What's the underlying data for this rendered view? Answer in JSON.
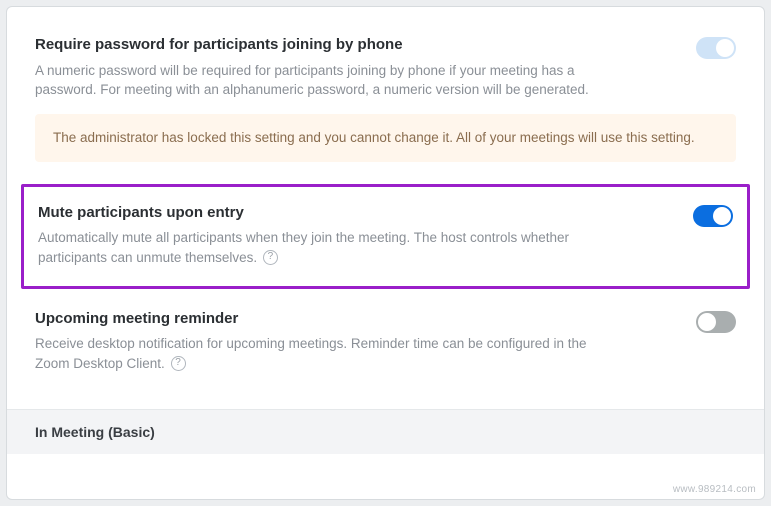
{
  "settings": [
    {
      "title": "Require password for participants joining by phone",
      "description": "A numeric password will be required for participants joining by phone if your meeting has a password. For meeting with an alphanumeric password, a numeric version will be generated.",
      "toggle_state": "on-locked",
      "locked_notice": "The administrator has locked this setting and you cannot change it. All of your meetings will use this setting.",
      "has_info_icon": false
    },
    {
      "title": "Mute participants upon entry",
      "description": "Automatically mute all participants when they join the meeting. The host controls whether participants can unmute themselves.",
      "toggle_state": "on",
      "highlighted": true,
      "has_info_icon": true
    },
    {
      "title": "Upcoming meeting reminder",
      "description": "Receive desktop notification for upcoming meetings. Reminder time can be configured in the Zoom Desktop Client.",
      "toggle_state": "off",
      "has_info_icon": true
    }
  ],
  "section_header": "In Meeting (Basic)",
  "watermark": "www.989214.com",
  "info_icon_text": "?"
}
